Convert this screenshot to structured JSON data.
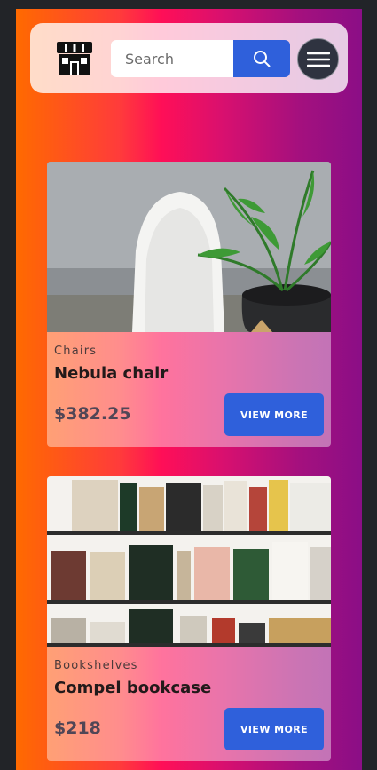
{
  "header": {
    "logo_icon": "storefront-icon",
    "search": {
      "placeholder": "Search",
      "value": "",
      "button_icon": "search-icon"
    },
    "menu_icon": "hamburger-menu-icon"
  },
  "products": [
    {
      "image": "chair-with-palm-plant-photo",
      "category": "Chairs",
      "title": "Nebula chair",
      "price": "$382.25",
      "button_label": "VIEW MORE"
    },
    {
      "image": "bookshelf-with-cookbooks-photo",
      "category": "Bookshelves",
      "title": "Compel bookcase",
      "price": "$218",
      "button_label": "VIEW MORE"
    }
  ],
  "colors": {
    "accent": "#2f60db",
    "menu_button": "#2f3340",
    "gradient": [
      "#ff6a00",
      "#ff0f57",
      "#8b0e86"
    ]
  }
}
